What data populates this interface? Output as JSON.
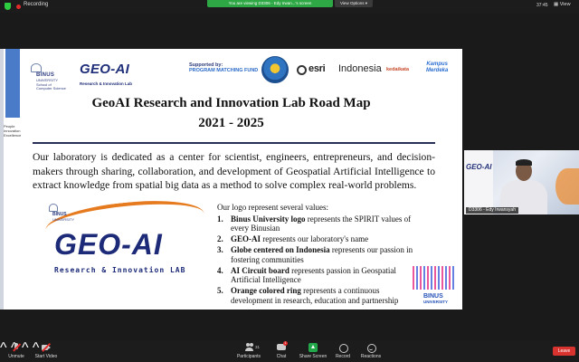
{
  "topbar": {
    "recording_label": "Recording",
    "share_banner": "You are viewing D3306 - Edy Irwan...'s screen",
    "view_options": "View Options ▾",
    "clock": "37:45",
    "view_label": "▦ View"
  },
  "slide": {
    "binus_header": {
      "word": "BINUS",
      "sub_lines": [
        "UNIVERSITY",
        "School of",
        "Computer Science"
      ]
    },
    "geoai_header": {
      "word": "GEO-AI",
      "sub": "Research & Innovation Lab"
    },
    "supported_by": "Supported by:",
    "program_fund": "PROGRAM MATCHING FUND",
    "esri": "esri",
    "indonesia": "Indonesia",
    "kedai": "kedaikata",
    "kampus": [
      "Kampus",
      "Merdeka"
    ],
    "people_tag": [
      "People",
      "Innovation",
      "Excellence"
    ],
    "title": "GeoAI Research and Innovation Lab Road Map",
    "years": "2021 - 2025",
    "intro": "Our laboratory is dedicated as a center for scientist, engineers, entrepreneurs, and decision-makers through sharing, collaboration, and development of Geospatial Artificial Intelligence to extract knowledge from spatial big data as a method to solve complex real-world problems.",
    "logo_big": {
      "binus": "BINUS",
      "university": "UNIVERSITY",
      "word": "GEO-AI",
      "sub": "Research & Innovation LAB"
    },
    "values_head": "Our logo represent several values:",
    "values": [
      {
        "num": "1.",
        "bold": "Binus University logo",
        "rest": " represents the SPIRIT values of every Binusian"
      },
      {
        "num": "2.",
        "bold": "GEO-AI",
        "rest": " represents our laboratory's name"
      },
      {
        "num": "3.",
        "bold": "Globe centered on Indonesia",
        "rest": " represents our passion in fostering communities"
      },
      {
        "num": "4.",
        "bold": "AI Circuit board",
        "rest": " represents passion in Geospatial Artificial Intelligence"
      },
      {
        "num": "5.",
        "bold": "Orange colored ring",
        "rest": " represents a continuous development in research, education and partnership"
      }
    ],
    "binus_br": {
      "name": "BINUS",
      "uni": "UNIVERSITY"
    }
  },
  "speaker": {
    "name": "D3306 - Edy Irwansyah",
    "bg_logo": "GEO-AI"
  },
  "toolbar": {
    "unmute": "Unmute",
    "start_video": "Start Video",
    "participants": "Participants",
    "participants_count": "31",
    "chat": "Chat",
    "chat_badge": "1",
    "share_screen": "Share Screen",
    "record": "Record",
    "reactions": "Reactions",
    "leave": "Leave"
  },
  "colors": {
    "slide_bg": "#ffffff",
    "geoai_blue": "#1c2a78",
    "accent_orange": "#e67a1e",
    "share_green": "#22a84a",
    "leave_red": "#d8332f"
  }
}
